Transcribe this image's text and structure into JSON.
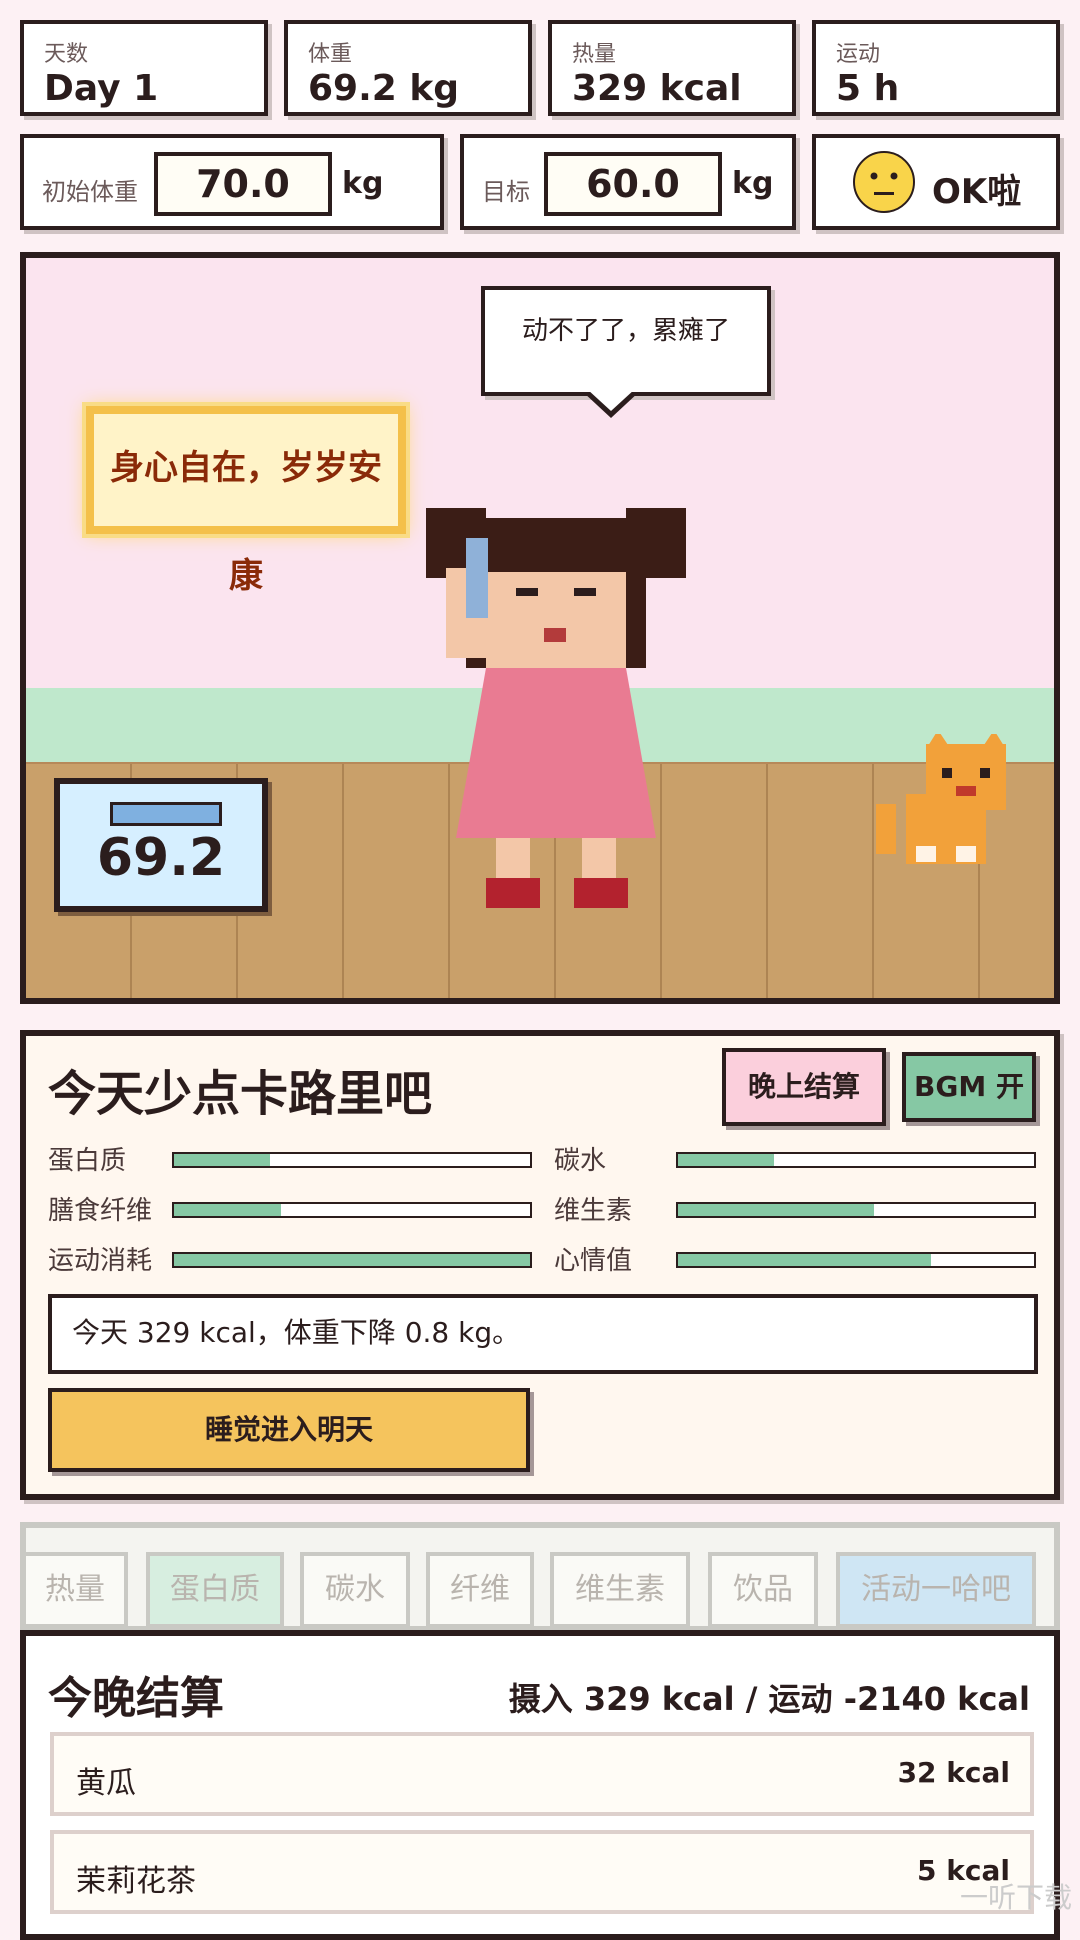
{
  "stats": [
    {
      "label": "天数",
      "value": "Day 1"
    },
    {
      "label": "体重",
      "value": "69.2 kg"
    },
    {
      "label": "热量",
      "value": "329 kcal"
    },
    {
      "label": "运动",
      "value": "5 h"
    }
  ],
  "settings": {
    "initial_label": "初始体重",
    "initial_value": "70.0",
    "initial_unit": "kg",
    "target_label": "目标",
    "target_value": "60.0",
    "target_unit": "kg",
    "mood_label": "OK啦"
  },
  "scene": {
    "speech": "动不了了，累瘫了",
    "plaque": "身心自在，岁岁安康",
    "scale_value": "69.2"
  },
  "panel": {
    "title": "今天少点卡路里吧",
    "settle_button": "晚上结算",
    "bgm_button": "BGM 开",
    "nutrients": [
      {
        "label": "蛋白质",
        "fill": 0.27
      },
      {
        "label": "碳水",
        "fill": 0.27
      },
      {
        "label": "膳食纤维",
        "fill": 0.3
      },
      {
        "label": "维生素",
        "fill": 0.55
      },
      {
        "label": "运动消耗",
        "fill": 1.0
      },
      {
        "label": "心情值",
        "fill": 0.71
      }
    ],
    "message": "今天 329 kcal，体重下降 0.8 kg。",
    "sleep_button": "睡觉进入明天"
  },
  "tabs": [
    "热量",
    "蛋白质",
    "碳水",
    "纤维",
    "维生素",
    "饮品",
    "活动一哈吧"
  ],
  "summary": {
    "title": "今晚结算",
    "stat": "摄入 329 kcal / 运动 -2140 kcal",
    "items": [
      {
        "name": "黄瓜",
        "kcal": "32 kcal"
      },
      {
        "name": "茉莉花茶",
        "kcal": "5 kcal"
      }
    ]
  },
  "watermark": "一听下载",
  "colors": {
    "accent_green": "#86c8a4",
    "sleep_yellow": "#f5c45d",
    "settle_pink": "#fbcfdc",
    "bgm_green": "#86c8a4",
    "tab_active_green": "#d7eee0",
    "tab_blue": "#cfe6f4"
  }
}
